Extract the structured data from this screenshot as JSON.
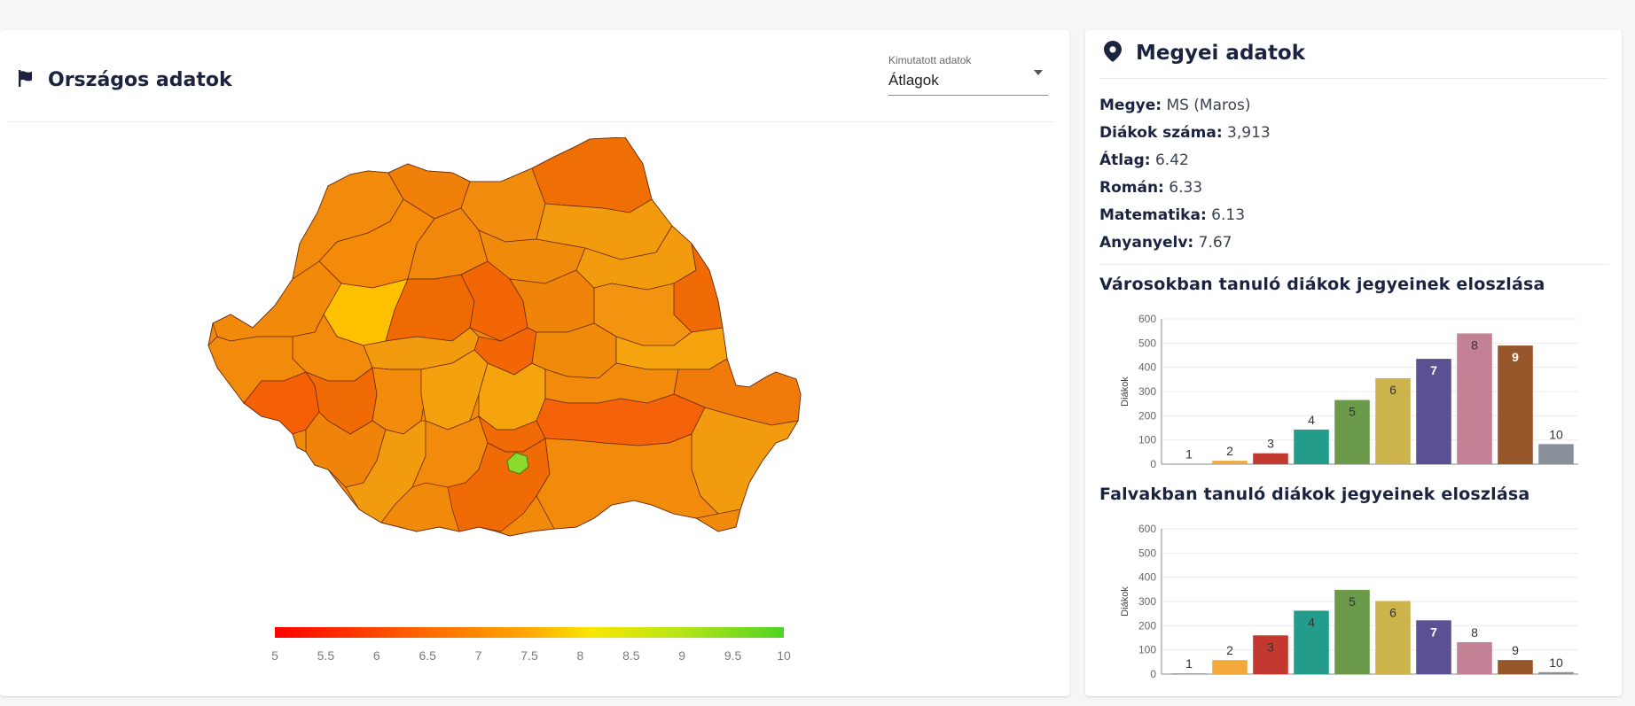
{
  "national": {
    "title": "Országos adatok",
    "icon": "flag-icon",
    "select": {
      "label": "Kimutatott adatok",
      "value": "Átlagok"
    },
    "scale": {
      "ticks": [
        "5",
        "5.5",
        "6",
        "6.5",
        "7",
        "7.5",
        "8",
        "8.5",
        "9",
        "9.5",
        "10"
      ],
      "colors": [
        "#ff0000",
        "#ffa800",
        "#4fd322"
      ]
    }
  },
  "county": {
    "title": "Megyei adatok",
    "icon": "map-pin-icon",
    "rows": [
      {
        "label": "Megye:",
        "value": "MS (Maros)"
      },
      {
        "label": "Diákok száma:",
        "value": "3,913"
      },
      {
        "label": "Átlag:",
        "value": "6.42"
      },
      {
        "label": "Román:",
        "value": "6.33"
      },
      {
        "label": "Matematika:",
        "value": "6.13"
      },
      {
        "label": "Anyanyelv:",
        "value": "7.67"
      }
    ]
  },
  "chart_data": [
    {
      "type": "bar",
      "title": "Városokban tanuló diákok jegyeinek eloszlása",
      "ylabel": "Diákok",
      "categories": [
        "1",
        "2",
        "3",
        "4",
        "5",
        "6",
        "7",
        "8",
        "9",
        "10"
      ],
      "values": [
        2,
        14,
        45,
        143,
        265,
        355,
        435,
        540,
        490,
        83
      ],
      "ylim": [
        0,
        600
      ],
      "yticks": [
        "0",
        "100",
        "200",
        "300",
        "400",
        "500",
        "600"
      ],
      "colors": [
        "#8a8f9c",
        "#f2a93b",
        "#c3392f",
        "#239c8c",
        "#6a9a4a",
        "#cdb34c",
        "#5b5192",
        "#c28194",
        "#98572b",
        "#8a8f9c"
      ]
    },
    {
      "type": "bar",
      "title": "Falvakban tanuló diákok jegyeinek eloszlása",
      "ylabel": "Diákok",
      "categories": [
        "1",
        "2",
        "3",
        "4",
        "5",
        "6",
        "7",
        "8",
        "9",
        "10"
      ],
      "values": [
        3,
        58,
        160,
        262,
        348,
        302,
        222,
        132,
        58,
        8
      ],
      "ylim": [
        0,
        600
      ],
      "yticks": [
        "0",
        "100",
        "200",
        "300",
        "400",
        "500",
        "600"
      ],
      "colors": [
        "#8a8f9c",
        "#f2a93b",
        "#c3392f",
        "#239c8c",
        "#6a9a4a",
        "#cdb34c",
        "#5b5192",
        "#c28194",
        "#98572b",
        "#8a8f9c"
      ]
    }
  ]
}
